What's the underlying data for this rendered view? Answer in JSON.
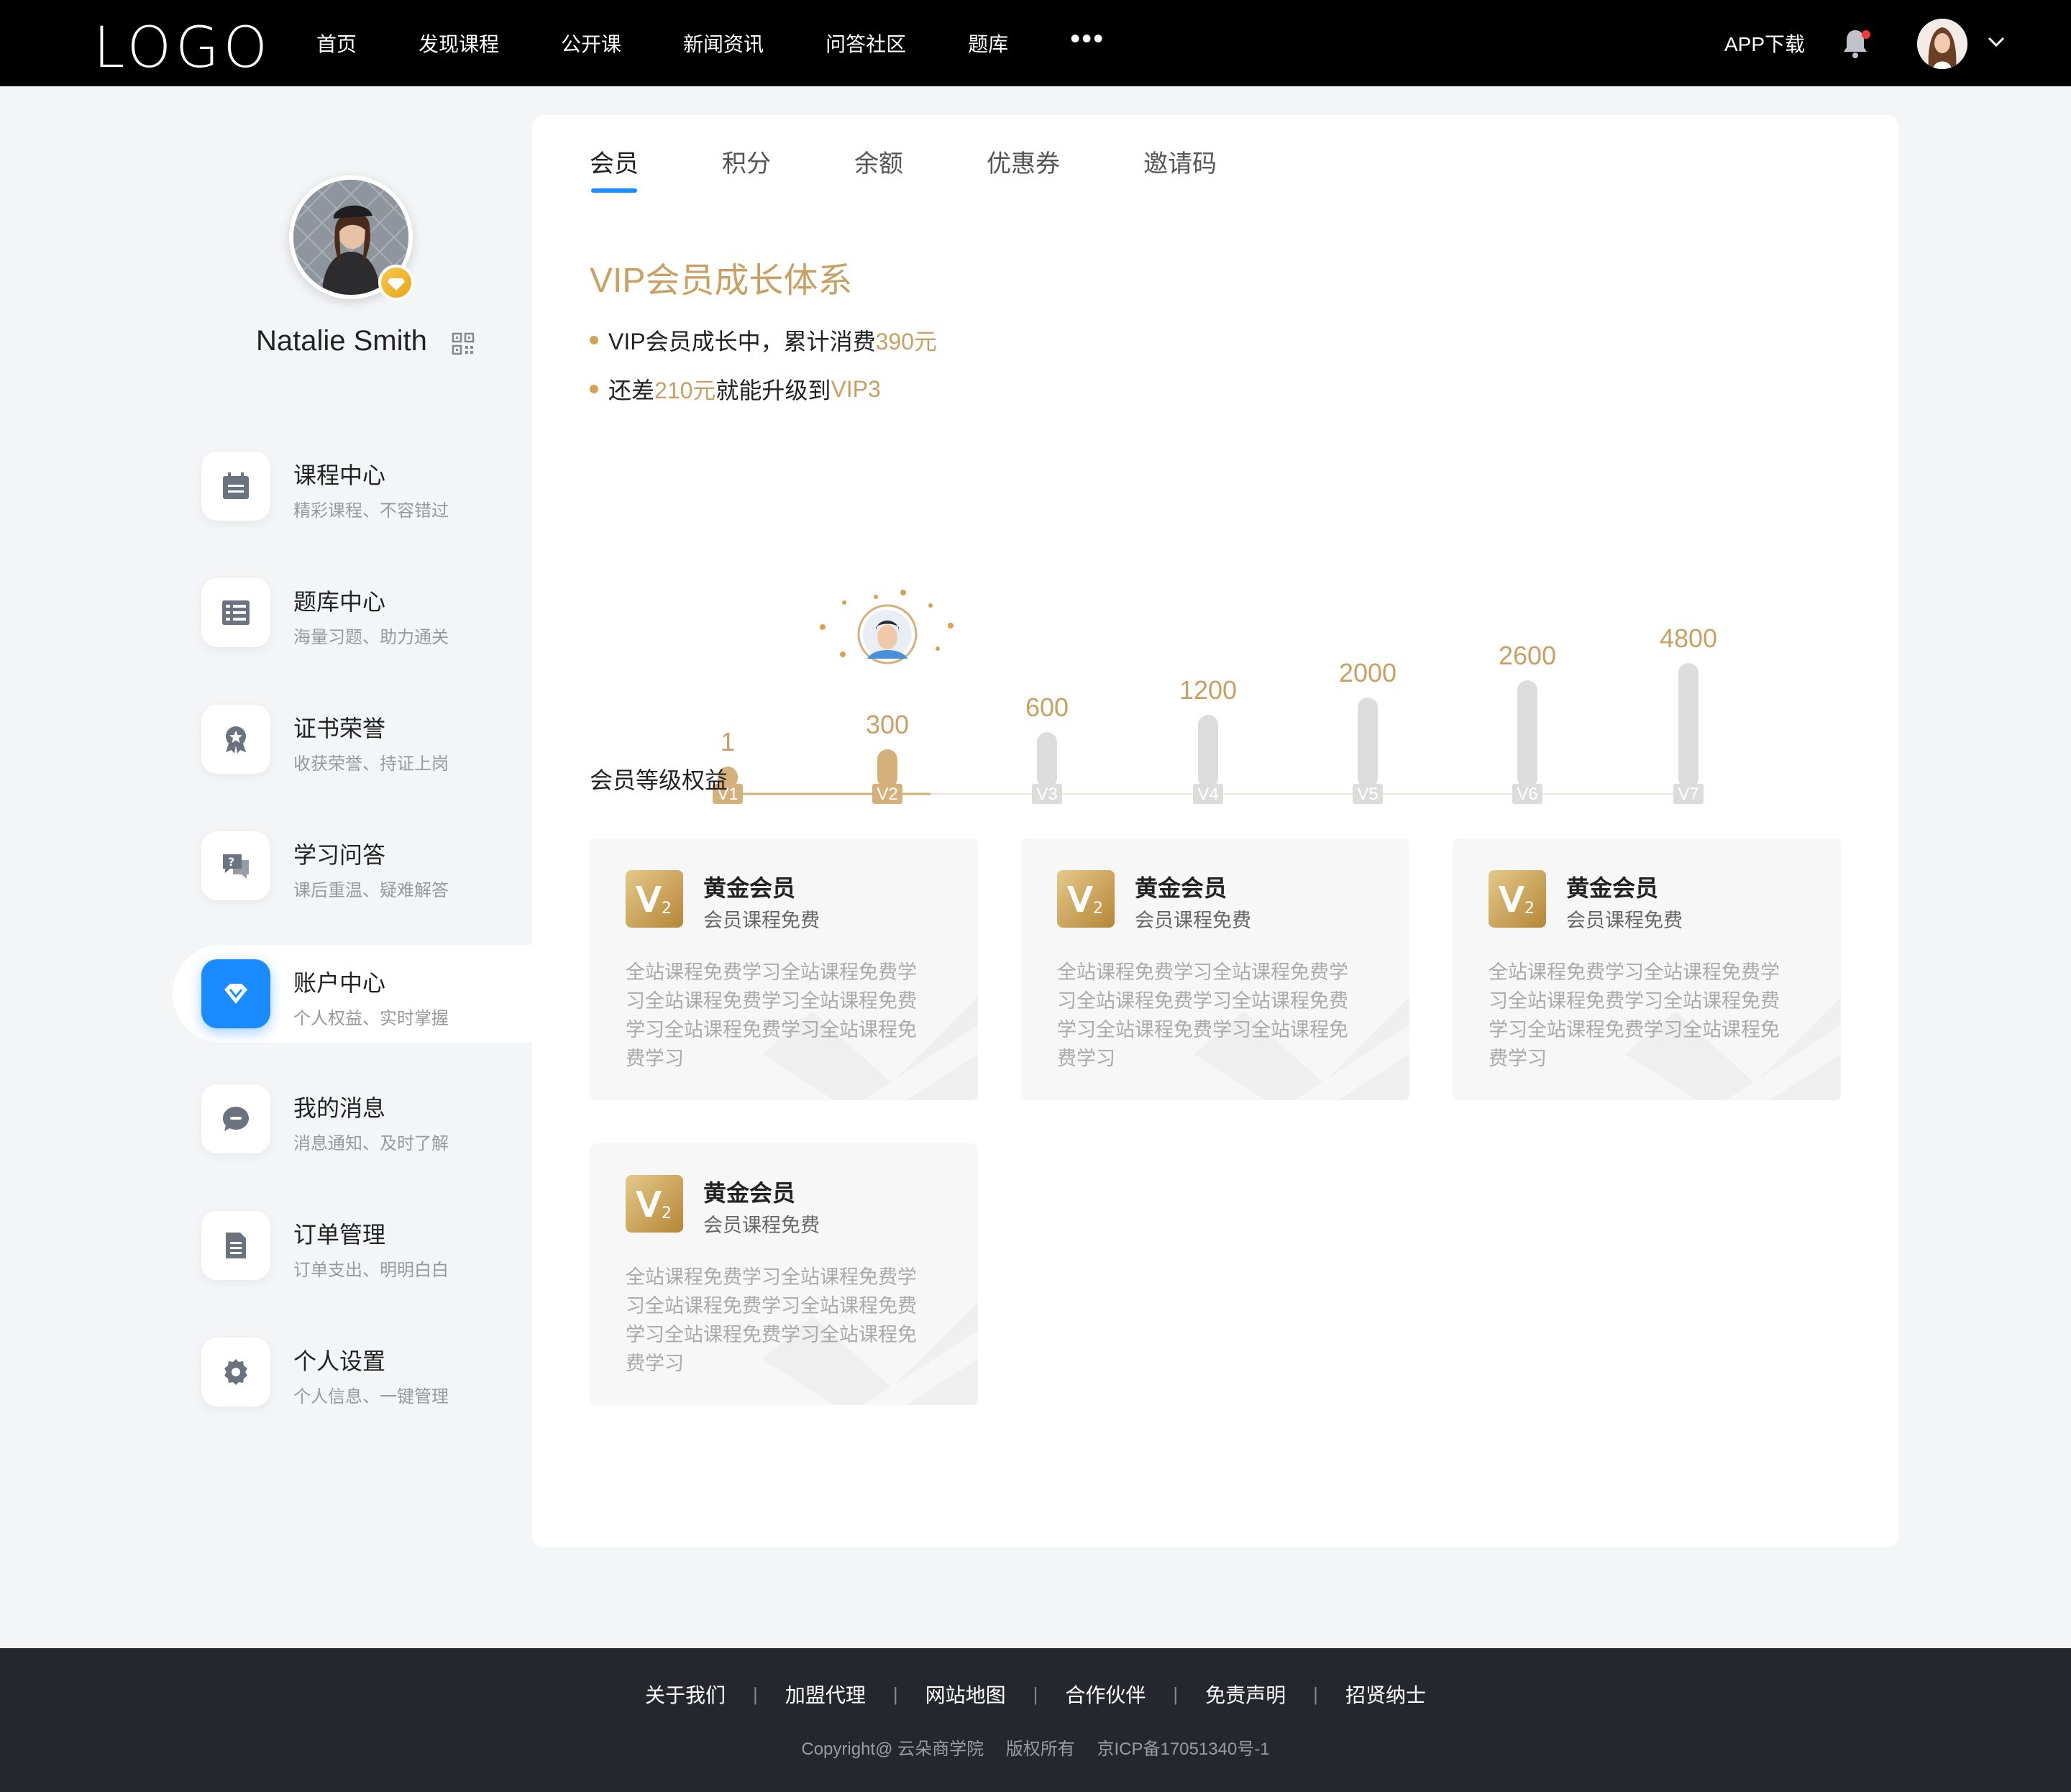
{
  "header": {
    "logo": "LOGO",
    "nav": [
      "首页",
      "发现课程",
      "公开课",
      "新闻资讯",
      "问答社区",
      "题库"
    ],
    "more": "•••",
    "app_download": "APP下载"
  },
  "profile": {
    "name": "Natalie Smith"
  },
  "menu": [
    {
      "title": "课程中心",
      "sub": "精彩课程、不容错过",
      "icon": "calendar-icon"
    },
    {
      "title": "题库中心",
      "sub": "海量习题、助力通关",
      "icon": "list-icon"
    },
    {
      "title": "证书荣誉",
      "sub": "收获荣誉、持证上岗",
      "icon": "award-icon"
    },
    {
      "title": "学习问答",
      "sub": "课后重温、疑难解答",
      "icon": "question-chat-icon"
    },
    {
      "title": "账户中心",
      "sub": "个人权益、实时掌握",
      "icon": "diamond-icon",
      "active": true
    },
    {
      "title": "我的消息",
      "sub": "消息通知、及时了解",
      "icon": "message-icon"
    },
    {
      "title": "订单管理",
      "sub": "订单支出、明明白白",
      "icon": "document-icon"
    },
    {
      "title": "个人设置",
      "sub": "个人信息、一键管理",
      "icon": "gear-icon"
    }
  ],
  "tabs": [
    "会员",
    "积分",
    "余额",
    "优惠券",
    "邀请码"
  ],
  "vip": {
    "title": "VIP会员成长体系",
    "line1_prefix": "VIP会员成长中，累计消费 ",
    "line1_amount": "390元",
    "line2_prefix": "还差",
    "line2_amount": "210元",
    "line2_mid": "就能升级到 ",
    "line2_level": "VIP3"
  },
  "chart_data": {
    "type": "bar",
    "categories": [
      "V1",
      "V2",
      "V3",
      "V4",
      "V5",
      "V6",
      "V7"
    ],
    "values": [
      1,
      300,
      600,
      1200,
      2000,
      2600,
      4800
    ],
    "value_labels": [
      "1",
      "300",
      "600",
      "1200",
      "2000",
      "2600",
      "4800"
    ],
    "achieved_levels": [
      "V1",
      "V2"
    ],
    "current_level": "V2",
    "colors": {
      "achieved": "#d4b07a",
      "pending": "#dcdcdc",
      "label": "#c9a064"
    }
  },
  "benefits": {
    "title": "会员等级权益",
    "cards": [
      {
        "title": "黄金会员",
        "sub": "会员课程免费",
        "desc": "全站课程免费学习全站课程免费学习全站课程免费学习全站课程免费学习全站课程免费学习全站课程免费学习"
      },
      {
        "title": "黄金会员",
        "sub": "会员课程免费",
        "desc": "全站课程免费学习全站课程免费学习全站课程免费学习全站课程免费学习全站课程免费学习全站课程免费学习"
      },
      {
        "title": "黄金会员",
        "sub": "会员课程免费",
        "desc": "全站课程免费学习全站课程免费学习全站课程免费学习全站课程免费学习全站课程免费学习全站课程免费学习"
      },
      {
        "title": "黄金会员",
        "sub": "会员课程免费",
        "desc": "全站课程免费学习全站课程免费学习全站课程免费学习全站课程免费学习全站课程免费学习全站课程免费学习"
      }
    ]
  },
  "footer": {
    "links": [
      "关于我们",
      "加盟代理",
      "网站地图",
      "合作伙伴",
      "免责声明",
      "招贤纳士"
    ],
    "copyright": "Copyright@ 云朵商学院",
    "rights": "版权所有",
    "icp": "京ICP备17051340号-1"
  }
}
